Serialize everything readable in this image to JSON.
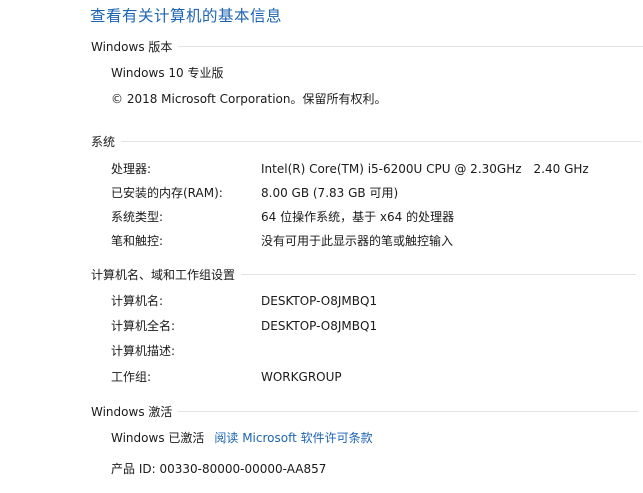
{
  "page_title": "查看有关计算机的基本信息",
  "windows_edition": {
    "header": "Windows 版本",
    "edition": "Windows 10 专业版",
    "copyright": "© 2018 Microsoft Corporation。保留所有权利。"
  },
  "system": {
    "header": "系统",
    "processor_label": "处理器:",
    "processor_value": "Intel(R) Core(TM) i5-6200U CPU @ 2.30GHz",
    "processor_speed": "2.40 GHz",
    "ram_label": "已安装的内存(RAM):",
    "ram_value": "8.00 GB (7.83 GB 可用)",
    "type_label": "系统类型:",
    "type_value": "64 位操作系统，基于 x64 的处理器",
    "pen_label": "笔和触控:",
    "pen_value": "没有可用于此显示器的笔或触控输入"
  },
  "computer_name": {
    "header": "计算机名、域和工作组设置",
    "name_label": "计算机名:",
    "name_value": "DESKTOP-O8JMBQ1",
    "full_name_label": "计算机全名:",
    "full_name_value": "DESKTOP-O8JMBQ1",
    "description_label": "计算机描述:",
    "description_value": "",
    "workgroup_label": "工作组:",
    "workgroup_value": "WORKGROUP"
  },
  "activation": {
    "header": "Windows 激活",
    "status": "Windows 已激活",
    "license_link": "阅读 Microsoft 软件许可条款",
    "product_id": "产品 ID: 00330-80000-00000-AA857"
  },
  "colors": {
    "link": "#1c64b4",
    "text": "#1a1a1a",
    "divider": "#e3e3e3"
  }
}
